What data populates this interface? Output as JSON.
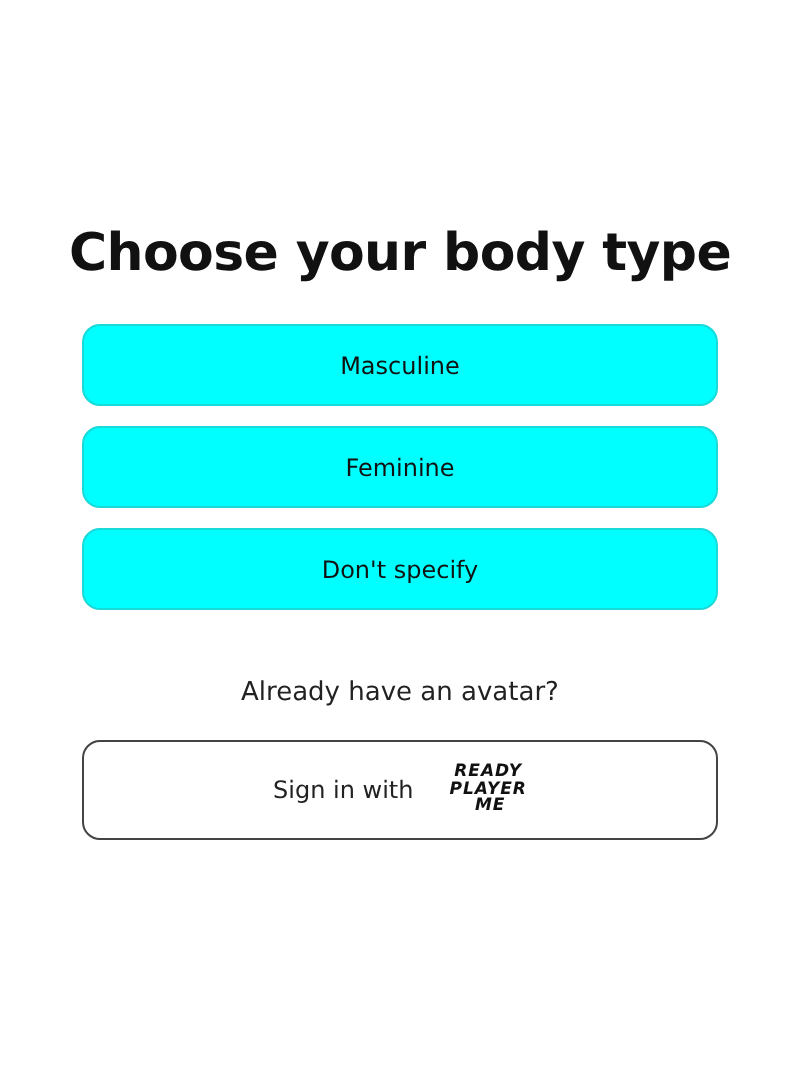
{
  "title": "Choose your body type",
  "options": [
    {
      "label": "Masculine"
    },
    {
      "label": "Feminine"
    },
    {
      "label": "Don't specify"
    }
  ],
  "prompt": "Already have an avatar?",
  "sign_in": {
    "label": "Sign in with",
    "logo_lines": [
      "READY",
      "PLAYER",
      "ME"
    ]
  }
}
